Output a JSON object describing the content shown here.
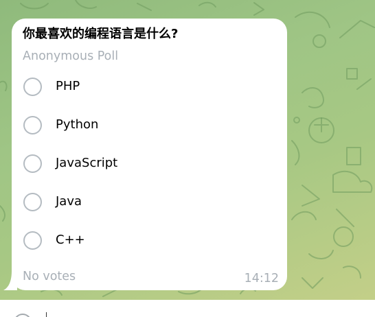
{
  "poll": {
    "question": "你最喜欢的编程语言是什么?",
    "type_label": "Anonymous Poll",
    "options": [
      {
        "label": "PHP"
      },
      {
        "label": "Python"
      },
      {
        "label": "JavaScript"
      },
      {
        "label": "Java"
      },
      {
        "label": "C++"
      }
    ],
    "votes_label": "No votes",
    "time": "14:12"
  },
  "colors": {
    "chat_background": "#9fc585",
    "bubble": "#ffffff",
    "secondary_text": "#a8afb6",
    "radio_border": "#b4bbc1"
  },
  "icons": {
    "composer": "emoji-icon"
  }
}
